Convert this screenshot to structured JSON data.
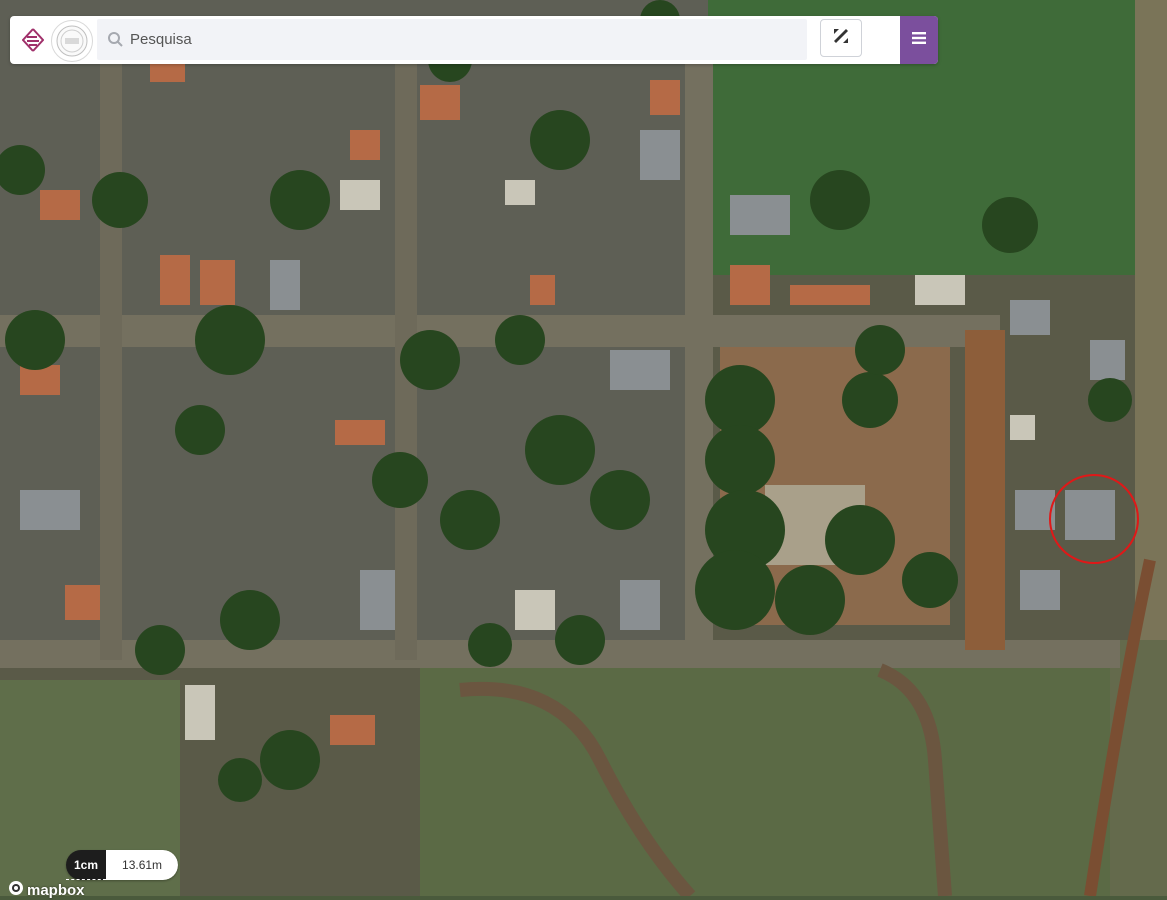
{
  "search": {
    "placeholder": "Pesquisa"
  },
  "scale": {
    "unit_label": "1cm",
    "distance_label": "13.61m"
  },
  "attribution": {
    "label": "mapbox"
  },
  "icons": {
    "brand": "brand-logo-icon",
    "seal": "municipal-seal-icon",
    "search": "search-icon",
    "tools": "measure-tools-icon",
    "menu": "hamburger-menu-icon",
    "mapbox": "mapbox-logo-icon"
  },
  "colors": {
    "accent": "#7b4f9d",
    "brand": "#a0306a",
    "marker": "#e01818"
  }
}
